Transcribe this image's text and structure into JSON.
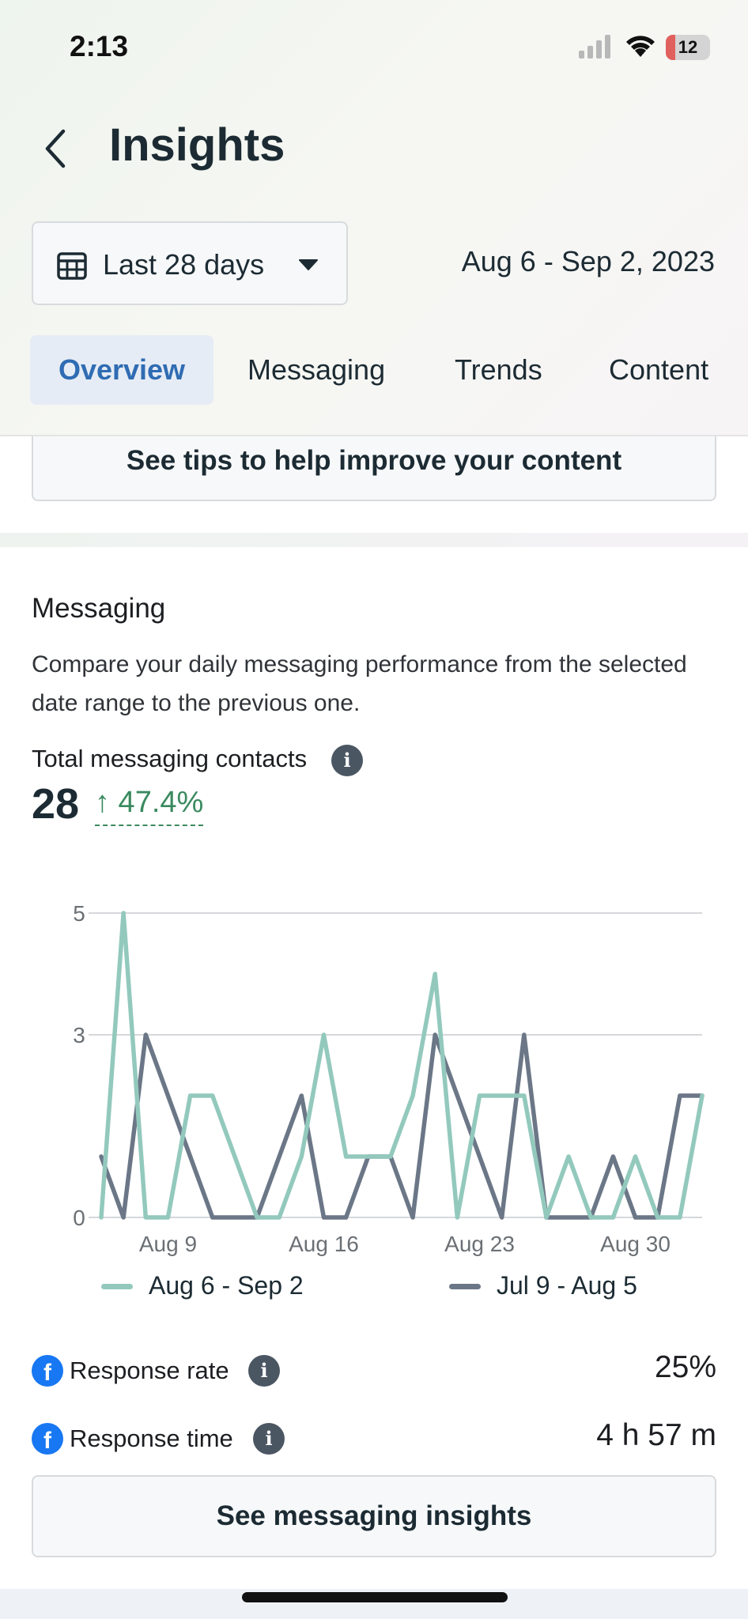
{
  "status_bar": {
    "time": "2:13",
    "battery": "12"
  },
  "header": {
    "title": "Insights",
    "date_filter": "Last 28 days",
    "date_range": "Aug 6 - Sep 2, 2023"
  },
  "tabs": [
    {
      "label": "Overview",
      "active": true
    },
    {
      "label": "Messaging",
      "active": false
    },
    {
      "label": "Trends",
      "active": false
    },
    {
      "label": "Content",
      "active": false
    }
  ],
  "tips_button": "See tips to help improve your content",
  "messaging": {
    "title": "Messaging",
    "description": "Compare your daily messaging performance from the selected date range to the previous one.",
    "metric_label": "Total messaging contacts",
    "metric_value": "28",
    "metric_change": "↑ 47.4%",
    "response_rate_label": "Response rate",
    "response_rate_value": "25%",
    "response_time_label": "Response time",
    "response_time_value": "4 h 57 m",
    "insights_button": "See messaging insights"
  },
  "colors": {
    "current_series": "#93c9bd",
    "previous_series": "#6b7787",
    "active_tab_bg": "#e6ecf5",
    "active_tab_text": "#2f6cb3",
    "positive_change": "#3a8a5f",
    "facebook_blue": "#1877f2"
  },
  "chart_data": {
    "type": "line",
    "y_ticks": [
      0,
      3,
      5
    ],
    "ylim": [
      0,
      5
    ],
    "x_tick_labels": [
      "Aug 9",
      "Aug 16",
      "Aug 23",
      "Aug 30"
    ],
    "x_tick_index": [
      3,
      10,
      17,
      24
    ],
    "series": [
      {
        "name": "Aug 6 - Sep 2",
        "color": "#93c9bd",
        "values": [
          0,
          5,
          0,
          0,
          2,
          2,
          1,
          0,
          0,
          1,
          3,
          1,
          1,
          1,
          2,
          4,
          0,
          2,
          2,
          2,
          0,
          1,
          0,
          0,
          1,
          0,
          0,
          2
        ]
      },
      {
        "name": "Jul 9 - Aug 5",
        "color": "#6b7787",
        "values": [
          1,
          0,
          3,
          2,
          1,
          0,
          0,
          0,
          1,
          2,
          0,
          0,
          1,
          1,
          0,
          3,
          2,
          1,
          0,
          3,
          0,
          0,
          0,
          1,
          0,
          0,
          2,
          2
        ]
      }
    ]
  },
  "icons": {
    "back": "chevron-left-icon",
    "calendar": "calendar-icon",
    "caret": "caret-down-icon",
    "info": "info-icon",
    "facebook": "facebook-icon"
  }
}
